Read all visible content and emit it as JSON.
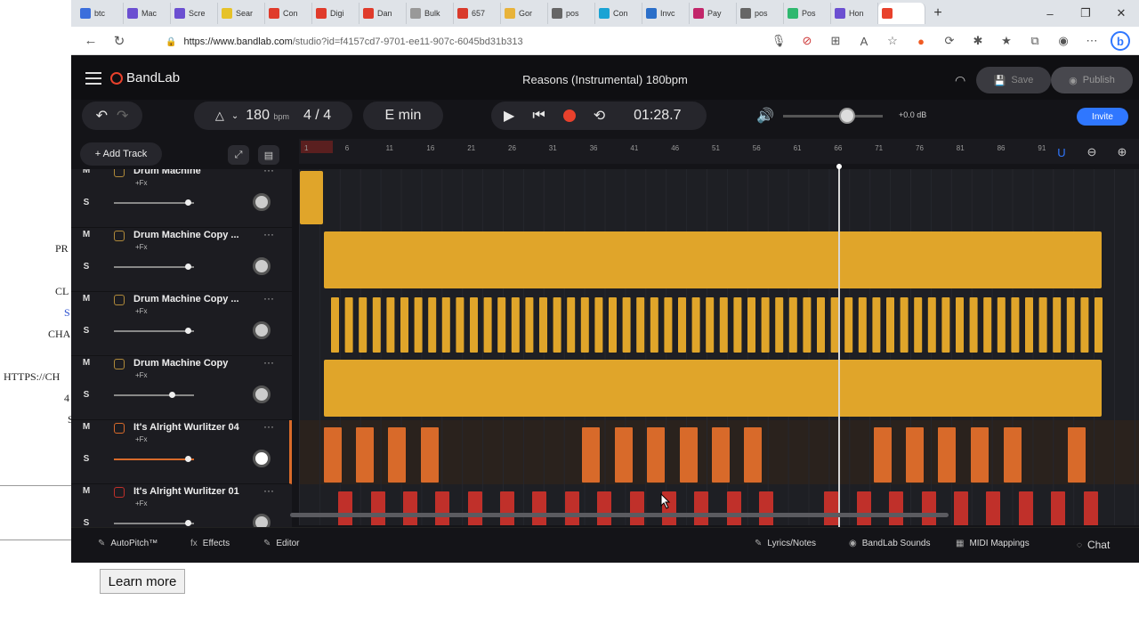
{
  "background_page": {
    "texts": [
      "PR",
      "CL",
      "S",
      "CHA",
      "HTTPS://CH",
      "4",
      "S"
    ],
    "learn_more": "Learn more"
  },
  "browser": {
    "tabs": [
      {
        "label": "btc",
        "color": "#3b6edc"
      },
      {
        "label": "Mac",
        "color": "#6b4fd1"
      },
      {
        "label": "Scre",
        "color": "#6b4fd1"
      },
      {
        "label": "Sear",
        "color": "#e6c229"
      },
      {
        "label": "Con",
        "color": "#e03b2b"
      },
      {
        "label": "Digi",
        "color": "#e03b2b"
      },
      {
        "label": "Dan",
        "color": "#e03b2b"
      },
      {
        "label": "Bulk",
        "color": "#999999"
      },
      {
        "label": "657",
        "color": "#d93a2b"
      },
      {
        "label": "Gor",
        "color": "#e8b33a"
      },
      {
        "label": "pos",
        "color": "#666666"
      },
      {
        "label": "Con",
        "color": "#1aa3d4"
      },
      {
        "label": "Invc",
        "color": "#2b6fc9"
      },
      {
        "label": "Pay",
        "color": "#c2266a"
      },
      {
        "label": "pos",
        "color": "#666666"
      },
      {
        "label": "Pos",
        "color": "#2fb86f"
      },
      {
        "label": "Hon",
        "color": "#6b4fd1"
      },
      {
        "label": "",
        "color": "#e8412c",
        "active": true
      }
    ],
    "new_tab": "+",
    "window_controls": [
      "–",
      "❐",
      "✕"
    ],
    "url": "https://www.bandlab.com/studio?id=f4157cd7-9701-ee11-907c-6045bd31b313",
    "url_host": "https://www.bandlab.com",
    "url_rest": "/studio?id=f4157cd7-9701-ee11-907c-6045bd31b313"
  },
  "app": {
    "brand": "BandLab",
    "project_title": "Reasons (Instrumental) 180bpm",
    "save_label": "Save",
    "publish_label": "Publish",
    "tempo": "180",
    "tempo_unit": "bpm",
    "time_signature": "4 / 4",
    "key": "E min",
    "time": "01:28.7",
    "volume_db": "+0.0 dB",
    "invite_label": "Invite",
    "add_track_label": "+ Add Track",
    "ruler_ticks": [
      "1",
      "6",
      "11",
      "16",
      "21",
      "26",
      "31",
      "36",
      "41",
      "46",
      "51",
      "56",
      "61",
      "66",
      "71",
      "76",
      "81",
      "86",
      "91"
    ],
    "tracks": [
      {
        "name": "Drum Machine",
        "fx": "+Fx",
        "mute": "M",
        "solo": "S",
        "icon": "drum-icon",
        "color": "#b08a3a"
      },
      {
        "name": "Drum Machine Copy ...",
        "fx": "+Fx",
        "mute": "M",
        "solo": "S",
        "icon": "drum-icon",
        "color": "#b08a3a"
      },
      {
        "name": "Drum Machine Copy ...",
        "fx": "+Fx",
        "mute": "M",
        "solo": "S",
        "icon": "drum-icon",
        "color": "#b08a3a"
      },
      {
        "name": "Drum Machine Copy",
        "fx": "+Fx",
        "mute": "M",
        "solo": "S",
        "icon": "drum-icon",
        "color": "#b08a3a"
      },
      {
        "name": "It's Alright Wurlitzer 04",
        "fx": "+Fx",
        "mute": "M",
        "solo": "S",
        "icon": "keys-icon",
        "color": "#d86a2a"
      },
      {
        "name": "It's Alright Wurlitzer 01",
        "fx": "+Fx",
        "mute": "M",
        "solo": "S",
        "icon": "keys-icon",
        "color": "#c0302a"
      }
    ],
    "footer": {
      "autopitch": "AutoPitch™",
      "effects": "Effects",
      "editor": "Editor",
      "lyrics": "Lyrics/Notes",
      "sounds": "BandLab Sounds",
      "midi": "MIDI Mappings",
      "chat": "Chat"
    },
    "colors": {
      "accent": "#e8412c",
      "drum_clip": "#e0a52a",
      "wurli_clip": "#d86a2a",
      "wurli2_clip": "#c0302a",
      "invite": "#2f77ff"
    }
  }
}
